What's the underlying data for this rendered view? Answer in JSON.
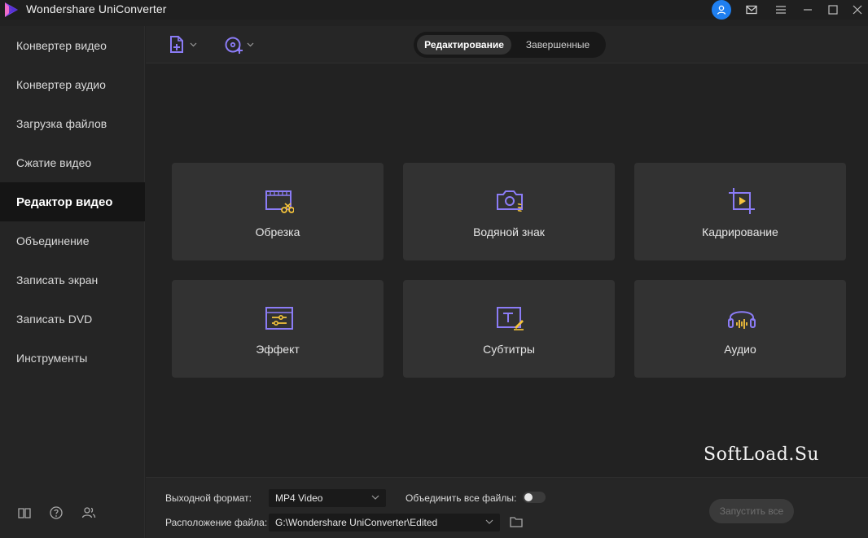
{
  "app": {
    "title": "Wondershare UniConverter"
  },
  "sidebar": {
    "items": [
      {
        "label": "Конвертер видео"
      },
      {
        "label": "Конвертер аудио"
      },
      {
        "label": "Загрузка файлов"
      },
      {
        "label": "Сжатие видео"
      },
      {
        "label": "Редактор видео",
        "active": true
      },
      {
        "label": "Объединение"
      },
      {
        "label": "Записать экран"
      },
      {
        "label": "Записать DVD"
      },
      {
        "label": "Инструменты"
      }
    ],
    "footer_icons": [
      "book-icon",
      "help-icon",
      "users-icon"
    ]
  },
  "toolbar": {
    "add_file_icon": "add-file-icon",
    "add_disc_icon": "add-disc-icon",
    "tabs": [
      {
        "label": "Редактирование",
        "active": true
      },
      {
        "label": "Завершенные",
        "active": false
      }
    ]
  },
  "cards": [
    {
      "label": "Обрезка",
      "icon": "trim-icon"
    },
    {
      "label": "Водяной знак",
      "icon": "watermark-icon"
    },
    {
      "label": "Кадрирование",
      "icon": "crop-icon"
    },
    {
      "label": "Эффект",
      "icon": "effect-icon"
    },
    {
      "label": "Субтитры",
      "icon": "subtitle-icon"
    },
    {
      "label": "Аудио",
      "icon": "audio-icon"
    }
  ],
  "watermark_text": "SoftLoad.Su",
  "bottom": {
    "output_format_label": "Выходной формат:",
    "output_format_value": "MP4 Video",
    "merge_label": "Объединить все файлы:",
    "merge_enabled": false,
    "location_label": "Расположение файла:",
    "location_value": "G:\\Wondershare UniConverter\\Edited",
    "start_label": "Запустить все"
  },
  "colors": {
    "accent_purple": "#8b7cf6",
    "accent_yellow": "#f5c33b",
    "avatar_blue": "#1f7ff0"
  }
}
